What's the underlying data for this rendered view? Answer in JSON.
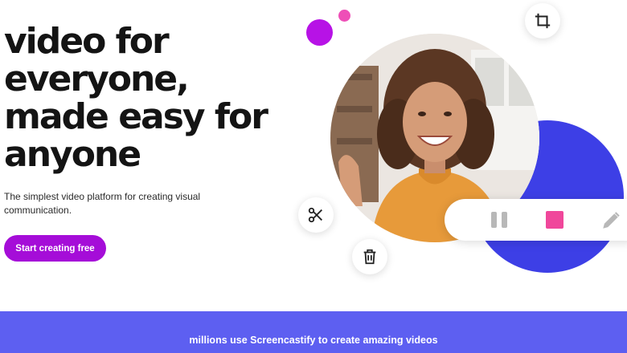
{
  "hero": {
    "title_lines": [
      "video for",
      "everyone,",
      "made easy for",
      "anyone"
    ],
    "subtitle": "The simplest video platform for creating visual communication.",
    "cta_label": "Start creating free"
  },
  "floating_buttons": [
    {
      "icon": "crop-icon"
    },
    {
      "icon": "scissors-icon"
    },
    {
      "icon": "trash-icon"
    }
  ],
  "recorder_toolbar": {
    "icons": [
      "pause-icon",
      "stop-icon",
      "pencil-icon"
    ],
    "stop_color": "#f0479b"
  },
  "banner": {
    "text": "millions use Screencastify to create amazing videos"
  },
  "colors": {
    "cta": "#a50dd8",
    "accent_purple": "#b712e6",
    "accent_pink": "#ee4fb7",
    "blue_circle": "#3d3fe6",
    "banner": "#5d5ff1"
  }
}
